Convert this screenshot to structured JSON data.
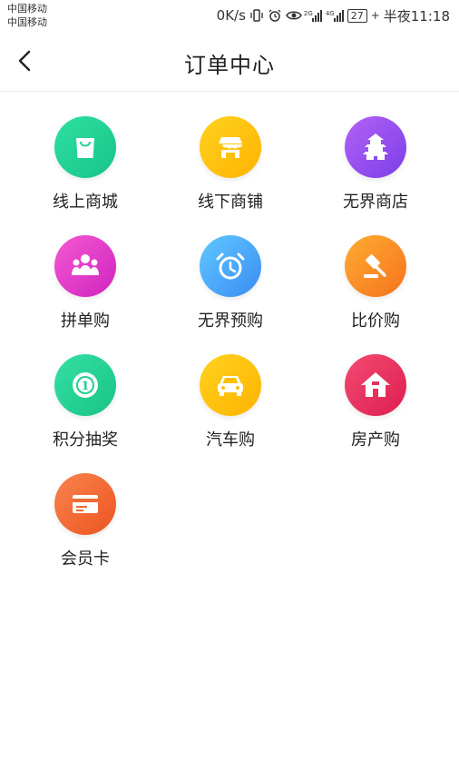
{
  "status_bar": {
    "carrier1": "中国移动",
    "carrier2": "中国移动",
    "speed": "0K/s",
    "net1": "2G",
    "net2": "4G",
    "battery": "27",
    "time": "半夜11:18"
  },
  "header": {
    "title": "订单中心"
  },
  "categories": [
    {
      "label": "线上商城",
      "icon": "shopping-bag-icon",
      "gradient": [
        "#2fe0a0",
        "#17c48a"
      ]
    },
    {
      "label": "线下商铺",
      "icon": "storefront-icon",
      "gradient": [
        "#ffd21f",
        "#ffb300"
      ]
    },
    {
      "label": "无界商店",
      "icon": "pagoda-icon",
      "gradient": [
        "#b362f5",
        "#7b3ee8"
      ]
    },
    {
      "label": "拼单购",
      "icon": "group-people-icon",
      "gradient": [
        "#f45ad2",
        "#d023c0"
      ]
    },
    {
      "label": "无界预购",
      "icon": "alarm-clock-icon",
      "gradient": [
        "#5fc8ff",
        "#3b8cf2"
      ]
    },
    {
      "label": "比价购",
      "icon": "gavel-icon",
      "gradient": [
        "#ffac33",
        "#f5731c"
      ]
    },
    {
      "label": "积分抽奖",
      "icon": "medal-coin-icon",
      "gradient": [
        "#36e0a4",
        "#19c386"
      ]
    },
    {
      "label": "汽车购",
      "icon": "car-icon",
      "gradient": [
        "#ffd21f",
        "#ffb300"
      ]
    },
    {
      "label": "房产购",
      "icon": "house-icon",
      "gradient": [
        "#f24b72",
        "#de1e4f"
      ]
    },
    {
      "label": "会员卡",
      "icon": "card-icon",
      "gradient": [
        "#f8844f",
        "#ec5420"
      ]
    }
  ]
}
